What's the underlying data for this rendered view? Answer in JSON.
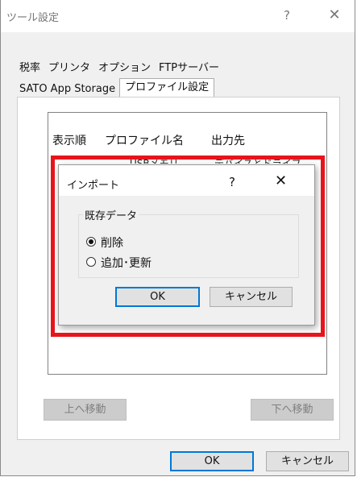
{
  "window": {
    "title": "ツール設定",
    "help_glyph": "?",
    "close_glyph": "✕"
  },
  "tabs_row1": [
    "税率",
    "プリンタ",
    "オプション",
    "FTPサーバー"
  ],
  "tabs_row2": [
    "SATO App Storage",
    "プロファイル設定"
  ],
  "active_tab": "プロファイル設定",
  "profile_list": {
    "columns": [
      "表示順",
      "プロファイル名",
      "出力先"
    ],
    "rows": [
      {
        "profile_name": "USBメモリ",
        "destination": "デバイスとドライブ"
      }
    ]
  },
  "buttons": {
    "move_up": "上へ移動",
    "move_down": "下へ移動",
    "ok": "OK",
    "cancel": "キャンセル"
  },
  "import_dialog": {
    "title": "インポート",
    "help_glyph": "?",
    "close_glyph": "✕",
    "group_label": "既存データ",
    "options": [
      {
        "label": "削除",
        "checked": true
      },
      {
        "label": "追加･更新",
        "checked": false
      }
    ],
    "ok": "OK",
    "cancel": "キャンセル"
  },
  "colors": {
    "highlight_border": "#e8141c",
    "default_button_border": "#0078d7"
  }
}
